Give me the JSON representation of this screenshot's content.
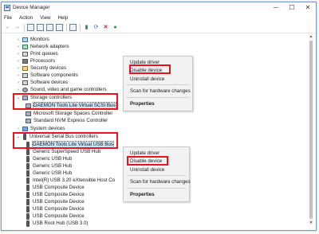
{
  "window": {
    "title": "Device Manager"
  },
  "window_controls": {
    "minimize": "─",
    "maximize": "☐",
    "close": "✕"
  },
  "menu": [
    "File",
    "Action",
    "View",
    "Help"
  ],
  "toolbar": {
    "back": "←",
    "forward": "→",
    "scan": "⟳",
    "remove": "✕",
    "enable": "●"
  },
  "tree": {
    "nodes": [
      {
        "label": "Monitors",
        "toggle": "›",
        "icon": "monitor-icon"
      },
      {
        "label": "Network adapters",
        "toggle": "›",
        "icon": "network-adapter-icon"
      },
      {
        "label": "Print queues",
        "toggle": "›",
        "icon": "printer-icon"
      },
      {
        "label": "Processors",
        "toggle": "›",
        "icon": "processor-icon"
      },
      {
        "label": "Security devices",
        "toggle": "›",
        "icon": "security-icon"
      },
      {
        "label": "Software components",
        "toggle": "›",
        "icon": "software-icon"
      },
      {
        "label": "Software devices",
        "toggle": "›",
        "icon": "software-icon"
      },
      {
        "label": "Sound, video and game controllers",
        "toggle": "›",
        "icon": "sound-icon"
      },
      {
        "label": "Storage controllers",
        "toggle": "⌄",
        "icon": "storage-icon"
      },
      {
        "label": "DAEMON Tools Lite Virtual SCSI Bus",
        "toggle": "",
        "icon": "storage-icon"
      },
      {
        "label": "Microsoft Storage Spaces Controller",
        "toggle": "",
        "icon": "storage-icon"
      },
      {
        "label": "Standard NVM Express Controller",
        "toggle": "",
        "icon": "storage-icon"
      },
      {
        "label": "System devices",
        "toggle": "›",
        "icon": "system-icon"
      },
      {
        "label": "Universal Serial Bus controllers",
        "toggle": "⌄",
        "icon": "usb-icon"
      },
      {
        "label": "DAEMON Tools Lite Virtual USB Bus",
        "toggle": "",
        "icon": "usb-icon"
      },
      {
        "label": "Generic SuperSpeed USB Hub",
        "toggle": "",
        "icon": "usb-icon"
      },
      {
        "label": "Generic USB Hub",
        "toggle": "",
        "icon": "usb-icon"
      },
      {
        "label": "Generic USB Hub",
        "toggle": "",
        "icon": "usb-icon"
      },
      {
        "label": "Generic USB Hub",
        "toggle": "",
        "icon": "usb-icon"
      },
      {
        "label": "Intel(R) USB 3.20 eXtensible Host Co",
        "toggle": "",
        "icon": "usb-icon"
      },
      {
        "label": "USB Composite Device",
        "toggle": "",
        "icon": "usb-icon"
      },
      {
        "label": "USB Composite Device",
        "toggle": "",
        "icon": "usb-icon"
      },
      {
        "label": "USB Composite Device",
        "toggle": "",
        "icon": "usb-icon"
      },
      {
        "label": "USB Composite Device",
        "toggle": "",
        "icon": "usb-icon"
      },
      {
        "label": "USB Composite Device",
        "toggle": "",
        "icon": "usb-icon"
      },
      {
        "label": "USB Root Hub (USB 3.0)",
        "toggle": "",
        "icon": "usb-icon"
      }
    ]
  },
  "context_menu_1": {
    "items": [
      "Update driver",
      "Disable device",
      "Uninstall device",
      "Scan for hardware changes",
      "Properties"
    ]
  },
  "context_menu_2": {
    "items": [
      "Update driver",
      "Disable device",
      "Uninstall device",
      "Scan for hardware changes",
      "Properties"
    ]
  },
  "colors": {
    "highlight": "#e8131c",
    "selection": "#cce4f7"
  }
}
